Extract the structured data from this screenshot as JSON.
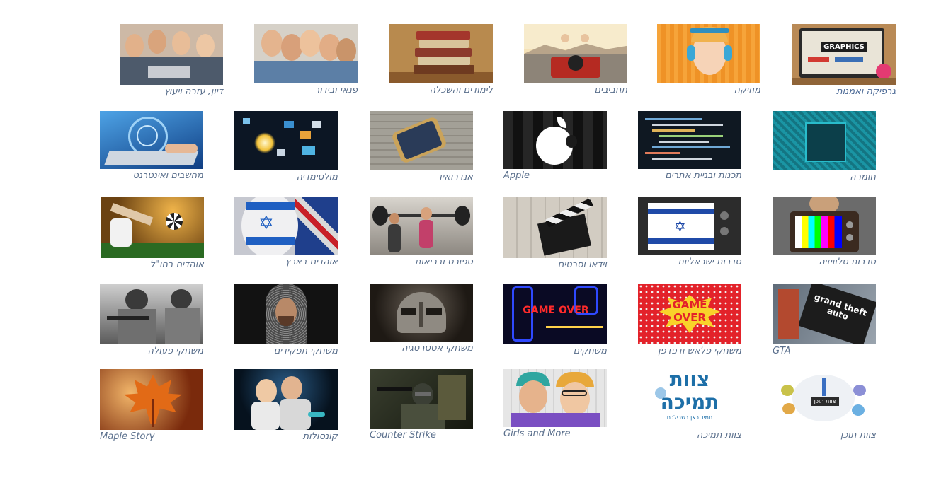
{
  "row1": [
    {
      "label": "גרפיקה ואמנות",
      "icon": "graphics-art-thumbnail",
      "link": true
    },
    {
      "label": "מוזיקה",
      "icon": "music-headphones-thumbnail"
    },
    {
      "label": "תחביבים",
      "icon": "hobbies-jeep-thumbnail"
    },
    {
      "label": "לימודים והשכלה",
      "icon": "books-stack-thumbnail"
    },
    {
      "label": "פנאי ובידור",
      "icon": "friends-selfie-thumbnail"
    },
    {
      "label": "דיון, עזרה ויעוץ",
      "icon": "discussion-group-thumbnail"
    }
  ],
  "row2": [
    {
      "label": "חומרה",
      "icon": "circuit-chip-thumbnail"
    },
    {
      "label": "תכנות ובניית אתרים",
      "icon": "code-screen-thumbnail"
    },
    {
      "label": "Apple",
      "icon": "apple-logo-thumbnail",
      "ltr": true
    },
    {
      "label": "אנדרואיד",
      "icon": "android-phone-thumbnail"
    },
    {
      "label": "מולטימדיה",
      "icon": "multimedia-burst-thumbnail"
    },
    {
      "label": "מחשבים ואינטרנט",
      "icon": "laptop-typing-thumbnail"
    }
  ],
  "row3": [
    {
      "label": "סדרות טלוויזיה",
      "icon": "retro-tv-thumbnail"
    },
    {
      "label": "סדרות ישראליות",
      "icon": "israel-flag-tv-thumbnail"
    },
    {
      "label": "וידאו וסרטים",
      "icon": "clapperboard-thumbnail"
    },
    {
      "label": "ספורט ובריאות",
      "icon": "gym-barbell-thumbnail"
    },
    {
      "label": "אוהדים בארץ",
      "icon": "flag-face-paint-thumbnail"
    },
    {
      "label": "אוהדים בחו\"ל",
      "icon": "soccer-kick-thumbnail"
    }
  ],
  "row4": [
    {
      "label": "GTA",
      "icon": "gta-cover-thumbnail",
      "ltr": true
    },
    {
      "label": "משחקי פלאש ודפדפן",
      "icon": "game-over-comic-thumbnail"
    },
    {
      "label": "משחקים",
      "icon": "game-over-pacman-thumbnail"
    },
    {
      "label": "משחקי אסטרטגיה",
      "icon": "viking-helmet-thumbnail"
    },
    {
      "label": "משחקי תפקידים",
      "icon": "knight-chainmail-thumbnail"
    },
    {
      "label": "משחקי פעולה",
      "icon": "soldiers-action-thumbnail"
    }
  ],
  "row5": [
    {
      "label": "צוות תוכן",
      "icon": "content-team-logo-thumbnail"
    },
    {
      "label": "צוות תמיכה",
      "icon": "support-team-logo-thumbnail"
    },
    {
      "label": "Girls and More",
      "icon": "two-girls-thumbnail",
      "ltr": true
    },
    {
      "label": "Counter Strike",
      "icon": "counter-strike-thumbnail",
      "ltr": true
    },
    {
      "label": "קונסולות",
      "icon": "console-players-thumbnail"
    },
    {
      "label": "Maple Story",
      "icon": "maple-leaf-thumbnail",
      "ltr": true
    }
  ],
  "logo_text": {
    "graphics": "GRAPHICS",
    "game_over": "GAME OVER",
    "game": "GAME",
    "over": "OVER",
    "gta": "grand theft auto",
    "support_team": "צוות",
    "support_team2": "תמיכה",
    "support_sub": "תמיד כאן בשבילכם",
    "content_team": "צוות תוכן"
  },
  "colors": {
    "caption": "#5a6f8c",
    "caption_link": "#4d6b97",
    "support_blue": "#1d6fa8"
  }
}
